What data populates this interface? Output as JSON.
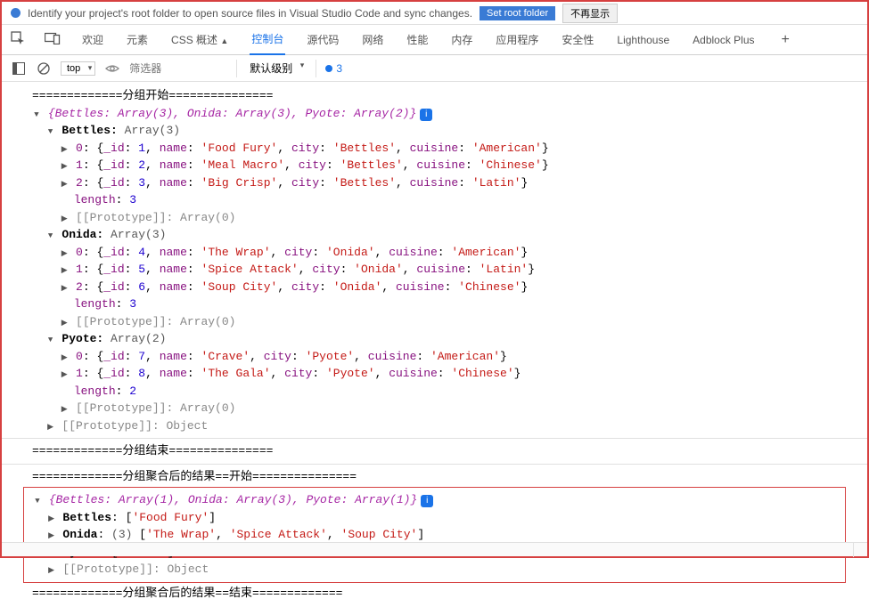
{
  "infobar": {
    "text": "Identify your project's root folder to open source files in Visual Studio Code and sync changes.",
    "btn_set": "Set root folder",
    "btn_dismiss": "不再显示"
  },
  "tabs": {
    "welcome": "欢迎",
    "elements": "元素",
    "css": "CSS 概述",
    "console": "控制台",
    "sources": "源代码",
    "network": "网络",
    "performance": "性能",
    "memory": "内存",
    "application": "应用程序",
    "security": "安全性",
    "lighthouse": "Lighthouse",
    "adblock": "Adblock Plus"
  },
  "filter": {
    "top": "top",
    "placeholder": "筛选器",
    "level": "默认级别",
    "badge_count": "3"
  },
  "log": {
    "line_group_start": "=============分组开始===============",
    "summary1_a": "{Bettles: Array(3), Onida: Array(3), Pyote: Array(2)}",
    "bettles_hdr": "Bettles: ",
    "bettles_type": "Array(3)",
    "b0": "0: {_id: 1, name: 'Food Fury', city: 'Bettles', cuisine: 'American'}",
    "b1": "1: {_id: 2, name: 'Meal Macro', city: 'Bettles', cuisine: 'Chinese'}",
    "b2": "2: {_id: 3, name: 'Big Crisp', city: 'Bettles', cuisine: 'Latin'}",
    "len3": "length: 3",
    "proto_arr": "[[Prototype]]: Array(0)",
    "onida_hdr": "Onida: ",
    "onida_type": "Array(3)",
    "o0": "0: {_id: 4, name: 'The Wrap', city: 'Onida', cuisine: 'American'}",
    "o1": "1: {_id: 5, name: 'Spice Attack', city: 'Onida', cuisine: 'Latin'}",
    "o2": "2: {_id: 6, name: 'Soup City', city: 'Onida', cuisine: 'Chinese'}",
    "pyote_hdr": "Pyote: ",
    "pyote_type": "Array(2)",
    "p0": "0: {_id: 7, name: 'Crave', city: 'Pyote', cuisine: 'American'}",
    "p1": "1: {_id: 8, name: 'The Gala', city: 'Pyote', cuisine: 'Chinese'}",
    "len2": "length: 2",
    "proto_obj": "[[Prototype]]: Object",
    "line_group_end": "=============分组结束===============",
    "line_agg_start": "=============分组聚合后的结果==开始===============",
    "summary2": "{Bettles: Array(1), Onida: Array(3), Pyote: Array(1)}",
    "r_bettles": "Bettles: ['Food Fury']",
    "r_onida": "Onida: (3) ['The Wrap', 'Spice Attack', 'Soup City']",
    "r_pyote": "Pyote: ['Crave']",
    "line_agg_end": "=============分组聚合后的结果==结束============="
  }
}
